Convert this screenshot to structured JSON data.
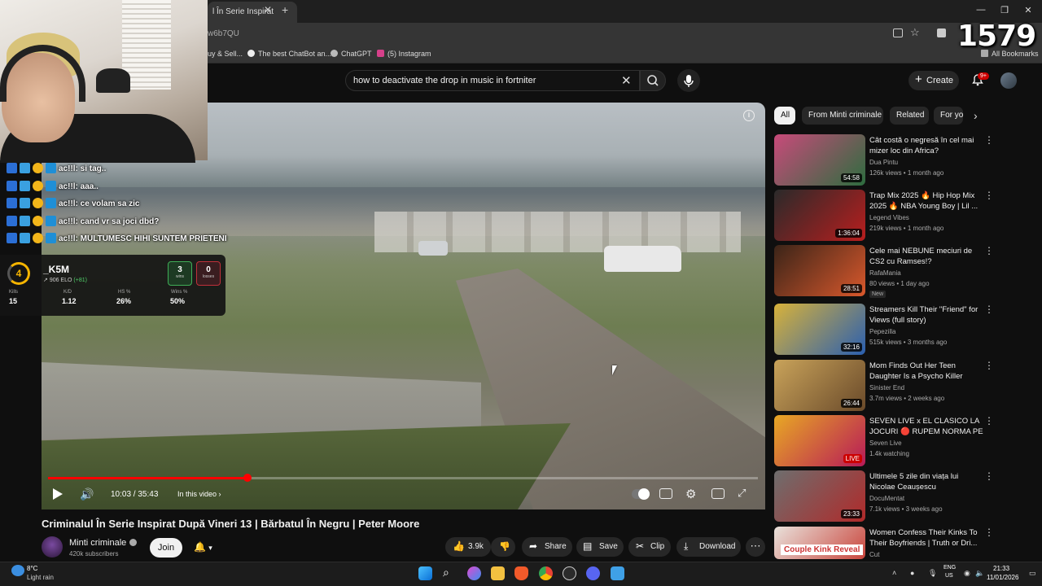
{
  "browser": {
    "tab_title": "l În Serie Inspirat",
    "url_fragment": "w6b7QU",
    "bookmarks": [
      "uy & Sell...",
      "The best ChatBot an...",
      "ChatGPT",
      "(5) Instagram"
    ],
    "all_bookmarks": "All Bookmarks"
  },
  "header": {
    "search_query": "how to deactivate the drop in music in fortniter",
    "create_label": "Create",
    "notif_badge": "9+"
  },
  "player": {
    "current_time": "10:03",
    "duration": "35:43",
    "time_display": "10:03 / 35:43",
    "progress_fraction": 0.281,
    "in_this_video": "In this video"
  },
  "video": {
    "title": "Criminalul În Serie Inspirat După Vineri 13 | Bărbatul În Negru | Peter Moore",
    "channel": "Minti criminale",
    "subscribers": "420k subscribers",
    "join_label": "Join",
    "likes": "3.9k",
    "share_label": "Share",
    "save_label": "Save",
    "clip_label": "Clip",
    "download_label": "Download"
  },
  "chips": [
    "All",
    "From Minti criminale",
    "Related",
    "For yo"
  ],
  "recommendations": [
    {
      "title": "Cât costă o negresă în cel mai mizer loc din Africa?",
      "channel": "Dua Pintu",
      "meta": "126k views • 1 month ago",
      "duration": "54:58",
      "colors": [
        "#c84a7a",
        "#2d6d3f"
      ]
    },
    {
      "title": "Trap Mix 2025 🔥 Hip Hop Mix 2025 🔥 NBA Young Boy | Lil ...",
      "channel": "Legend Vibes",
      "meta": "219k views • 1 month ago",
      "duration": "1:36:04",
      "colors": [
        "#2a2a2a",
        "#b81e1e"
      ]
    },
    {
      "title": "Cele mai NEBUNE meciuri de CS2 cu Ramses!?",
      "channel": "RafaMania",
      "meta": "80 views • 1 day ago",
      "duration": "28:51",
      "badge": "New",
      "colors": [
        "#3a2418",
        "#d9582c"
      ]
    },
    {
      "title": "Streamers Kill Their \"Friend\" for Views (full story)",
      "channel": "Pepezilla",
      "meta": "515k views • 3 months ago",
      "duration": "32:16",
      "colors": [
        "#d8b23a",
        "#2a5fb0"
      ]
    },
    {
      "title": "Mom Finds Out Her Teen Daughter Is a Psycho Killer",
      "channel": "Sinister End",
      "meta": "3.7m views • 2 weeks ago",
      "duration": "26:44",
      "colors": [
        "#c9a35a",
        "#6a4a2a"
      ]
    },
    {
      "title": "SEVEN LIVE x EL CLASICO LA JOCURI 🔴 RUPEM NORMA PE ...",
      "channel": "Seven Live",
      "meta": "1.4k watching",
      "duration": "LIVE",
      "live": true,
      "colors": [
        "#e8a824",
        "#b71a58"
      ]
    },
    {
      "title": "Ultimele 5 zile din viața lui Nicolae Ceaușescu",
      "channel": "DocuMentat",
      "meta": "7.1k views • 3 weeks ago",
      "duration": "23:33",
      "colors": [
        "#6e6e6e",
        "#b02a2a"
      ]
    },
    {
      "title": "Women Confess Their Kinks To Their Boyfriends | Truth or Dri...",
      "channel": "Cut",
      "meta": "",
      "duration": "",
      "thumb_text": "Couple Kink Reveal",
      "colors": [
        "#e9e2dc",
        "#c9453c"
      ]
    }
  ],
  "stream_overlay": {
    "viewer_count": "1579",
    "chat": [
      {
        "user": "ac!!l",
        "message": "si tag.."
      },
      {
        "user": "ac!!l",
        "message": "aaa.."
      },
      {
        "user": "ac!!l",
        "message": "ce volam sa zic"
      },
      {
        "user": "ac!!l",
        "message": "cand vr sa joci dbd?"
      },
      {
        "user": "ac!!l",
        "message": "MULTUMESC HIHI SUNTEM PRIETENI"
      }
    ],
    "faceit": {
      "level": "4",
      "name": "_K5M",
      "elo": "906 ELO",
      "elo_delta": "(+81)",
      "wins": "3",
      "wins_label": "wins",
      "losses": "0",
      "losses_label": "losses",
      "stats": [
        {
          "label": "Kills",
          "value": "15"
        },
        {
          "label": "K/D",
          "value": "1.12"
        },
        {
          "label": "HS %",
          "value": "26%"
        },
        {
          "label": "Wins %",
          "value": "50%"
        }
      ]
    }
  },
  "taskbar": {
    "temp": "8°C",
    "weather": "Light rain",
    "lang1": "ENG",
    "lang2": "US",
    "time": "21:33",
    "date": "11/01/2026"
  }
}
